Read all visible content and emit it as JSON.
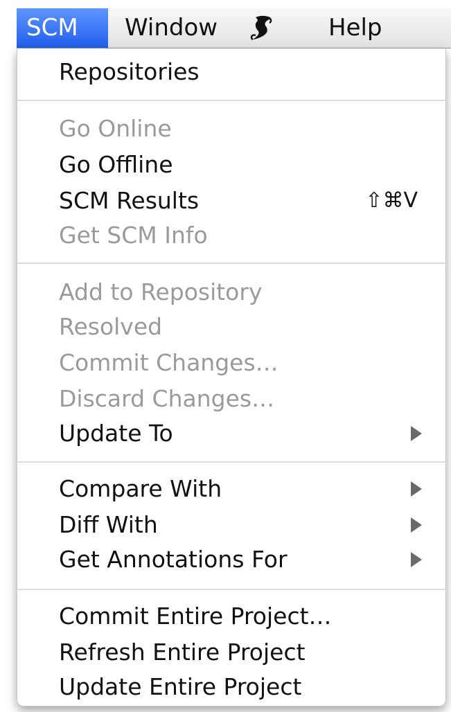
{
  "menubar": {
    "items": [
      {
        "label": "SCM"
      },
      {
        "label": "Window"
      },
      {
        "label": ""
      },
      {
        "label": "Help"
      }
    ],
    "script_icon": "script-menu-icon"
  },
  "menu": {
    "items": [
      {
        "label": "Repositories",
        "enabled": true
      },
      {
        "label": "Go Online",
        "enabled": false
      },
      {
        "label": "Go Offline",
        "enabled": true
      },
      {
        "label": "SCM Results",
        "enabled": true,
        "shortcut": "⇧⌘V"
      },
      {
        "label": "Get SCM Info",
        "enabled": false
      },
      {
        "label": "Add to Repository",
        "enabled": false
      },
      {
        "label": "Resolved",
        "enabled": false
      },
      {
        "label": "Commit Changes…",
        "enabled": false
      },
      {
        "label": "Discard Changes…",
        "enabled": false
      },
      {
        "label": "Update To",
        "enabled": true,
        "submenu": true
      },
      {
        "label": "Compare With",
        "enabled": true,
        "submenu": true
      },
      {
        "label": "Diff With",
        "enabled": true,
        "submenu": true
      },
      {
        "label": "Get Annotations For",
        "enabled": true,
        "submenu": true
      },
      {
        "label": "Commit Entire Project…",
        "enabled": true
      },
      {
        "label": "Refresh Entire Project",
        "enabled": true
      },
      {
        "label": "Update Entire Project",
        "enabled": true
      }
    ]
  },
  "colors": {
    "accent": "#2a66f0",
    "disabled_text": "#9a9a9a",
    "text": "#111111"
  }
}
